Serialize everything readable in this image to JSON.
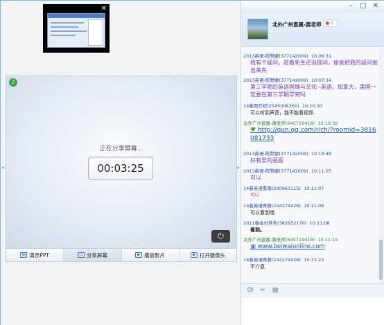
{
  "window": {
    "controls": [
      "–",
      "□",
      "✕"
    ]
  },
  "thumbnail": {
    "close_label": "✕"
  },
  "stage": {
    "sharing_text": "正在分享屏幕...",
    "timer": "00:03:25"
  },
  "toolbar": {
    "items": [
      {
        "label": "演示PPT",
        "icon": "ppt-icon"
      },
      {
        "label": "分享屏幕",
        "icon": "share-screen-icon"
      },
      {
        "label": "播放影片",
        "icon": "play-movie-icon"
      },
      {
        "label": "打开摄像头",
        "icon": "camera-icon"
      }
    ]
  },
  "group": {
    "name": "北外广州直属-黄老师",
    "badge_count": "0"
  },
  "messages": [
    {
      "sender": "2013英语-陈默娜(377142009)",
      "time": "10:06:31",
      "text": "我有个疑问，趁着新生还没提问，偷偷把我的疑问抛出来先",
      "color": "#7a3bb5",
      "size": "9px",
      "link": false
    },
    {
      "sender": "2013英语-陈默娜(377142009)",
      "time": "10:07:34",
      "text": "第三学期的英语国情与文化--英语，加拿大，美国一定要在第三学期学完吗",
      "color": "#7a3bb5",
      "size": "9px",
      "link": false
    },
    {
      "sender": "14春雨方权(2545006360)",
      "time": "10:10:30",
      "text": "可以听到声音，能不能看视频",
      "color": "#222222",
      "size": "7.5px",
      "link": false
    },
    {
      "sender": "北外广州直属-黄老师(645719418)",
      "time": "10:10:32",
      "text": "http://qun.qq.com/rich/?roomid=3816081733",
      "color": "#1a5fb4",
      "size": "10px",
      "link": true,
      "green": true
    },
    {
      "sender": "2013英语-陈默娜(377142009)",
      "time": "10:10:48",
      "text": "好有爱的画面",
      "color": "#7a3bb5",
      "size": "8.5px",
      "link": false
    },
    {
      "sender": "2013英语-陈默娜(377142009)",
      "time": "10:11:05",
      "text": "可以",
      "color": "#7a3bb5",
      "size": "8.5px",
      "link": false
    },
    {
      "sender": "14春英语重雨(290963115)",
      "time": "10:11:07",
      "text": "可以",
      "color": "#d23c6e",
      "size": "7px",
      "link": false
    },
    {
      "sender": "14春英语再蓉(244274426)",
      "time": "10:11:08",
      "text": "可以看到哦",
      "color": "#222222",
      "size": "7.5px",
      "link": false
    },
    {
      "sender": "2011春本付芳秀(382652170)",
      "time": "10:11:08",
      "text": "看到。",
      "color": "#111111",
      "size": "7.5px",
      "link": false,
      "bold": true
    },
    {
      "sender": "北外广州直属-黄老师(645719418)",
      "time": "10:11:15",
      "text": "www.beiwaionline.com",
      "color": "#1a5fb4",
      "size": "9.5px",
      "link": true,
      "green": true
    },
    {
      "sender": "14春英语再蓉(244274426)",
      "time": "10:13:23",
      "text": "不介意",
      "color": "#222222",
      "size": "7.5px",
      "link": false
    }
  ],
  "input_toolbar": {
    "icons": [
      "emoji-icon",
      "scissors-icon",
      "image-icon"
    ]
  },
  "colors": {
    "accent": "#1f4fa6",
    "teacher_name": "#2e8b2e",
    "purple_msg": "#7a3bb5"
  }
}
